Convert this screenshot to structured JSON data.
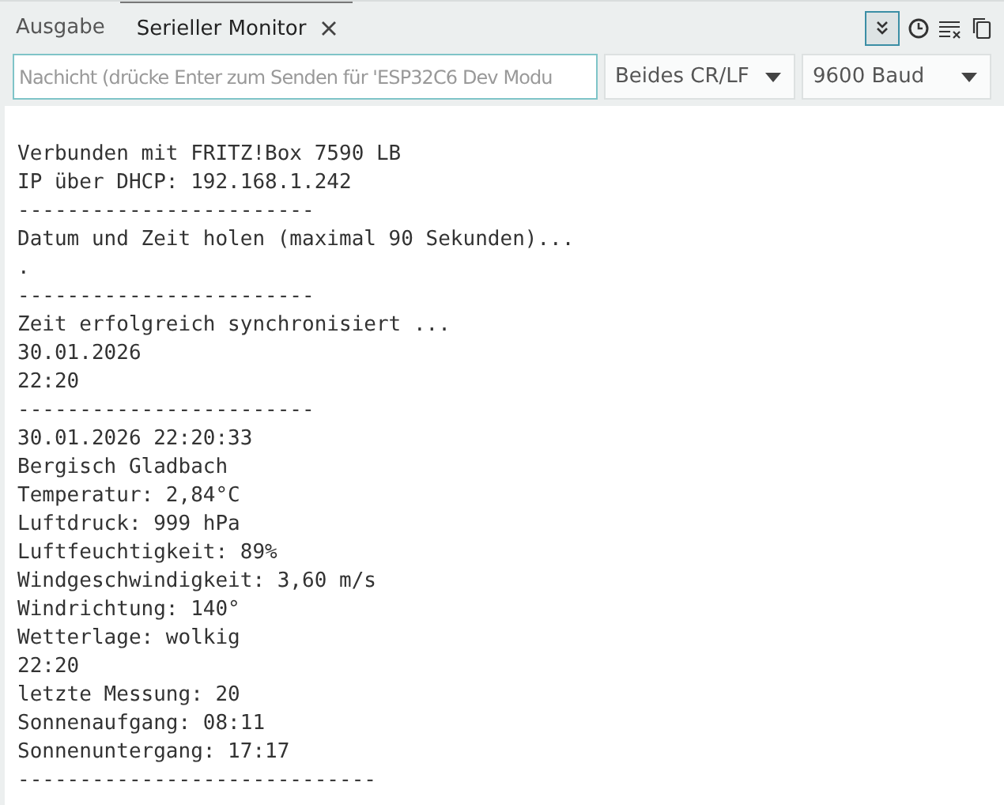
{
  "tabs": [
    {
      "label": "Ausgabe",
      "selected": false,
      "closable": false
    },
    {
      "label": "Serieller Monitor",
      "selected": true,
      "closable": true
    }
  ],
  "toolbar": {
    "autoscroll_on": true
  },
  "message": {
    "placeholder": "Nachicht (drücke Enter zum Senden für 'ESP32C6 Dev Modu"
  },
  "line_ending": {
    "value": "Beides CR/LF"
  },
  "baud_rate": {
    "value": "9600 Baud"
  },
  "output_lines": [
    "Verbunden mit FRITZ!Box 7590 LB",
    "IP über DHCP: 192.168.1.242",
    "------------------------",
    "Datum und Zeit holen (maximal 90 Sekunden)...",
    ".",
    "------------------------",
    "Zeit erfolgreich synchronisiert ...",
    "30.01.2026",
    "22:20",
    "------------------------",
    "30.01.2026 22:20:33",
    "Bergisch Gladbach",
    "Temperatur: 2,84°C",
    "Luftdruck: 999 hPa",
    "Luftfeuchtigkeit: 89%",
    "Windgeschwindigkeit: 3,60 m/s",
    "Windrichtung: 140°",
    "Wetterlage: wolkig",
    "22:20",
    "letzte Messung: 20",
    "Sonnenaufgang: 08:11",
    "Sonnenuntergang: 17:17",
    "-----------------------------"
  ]
}
